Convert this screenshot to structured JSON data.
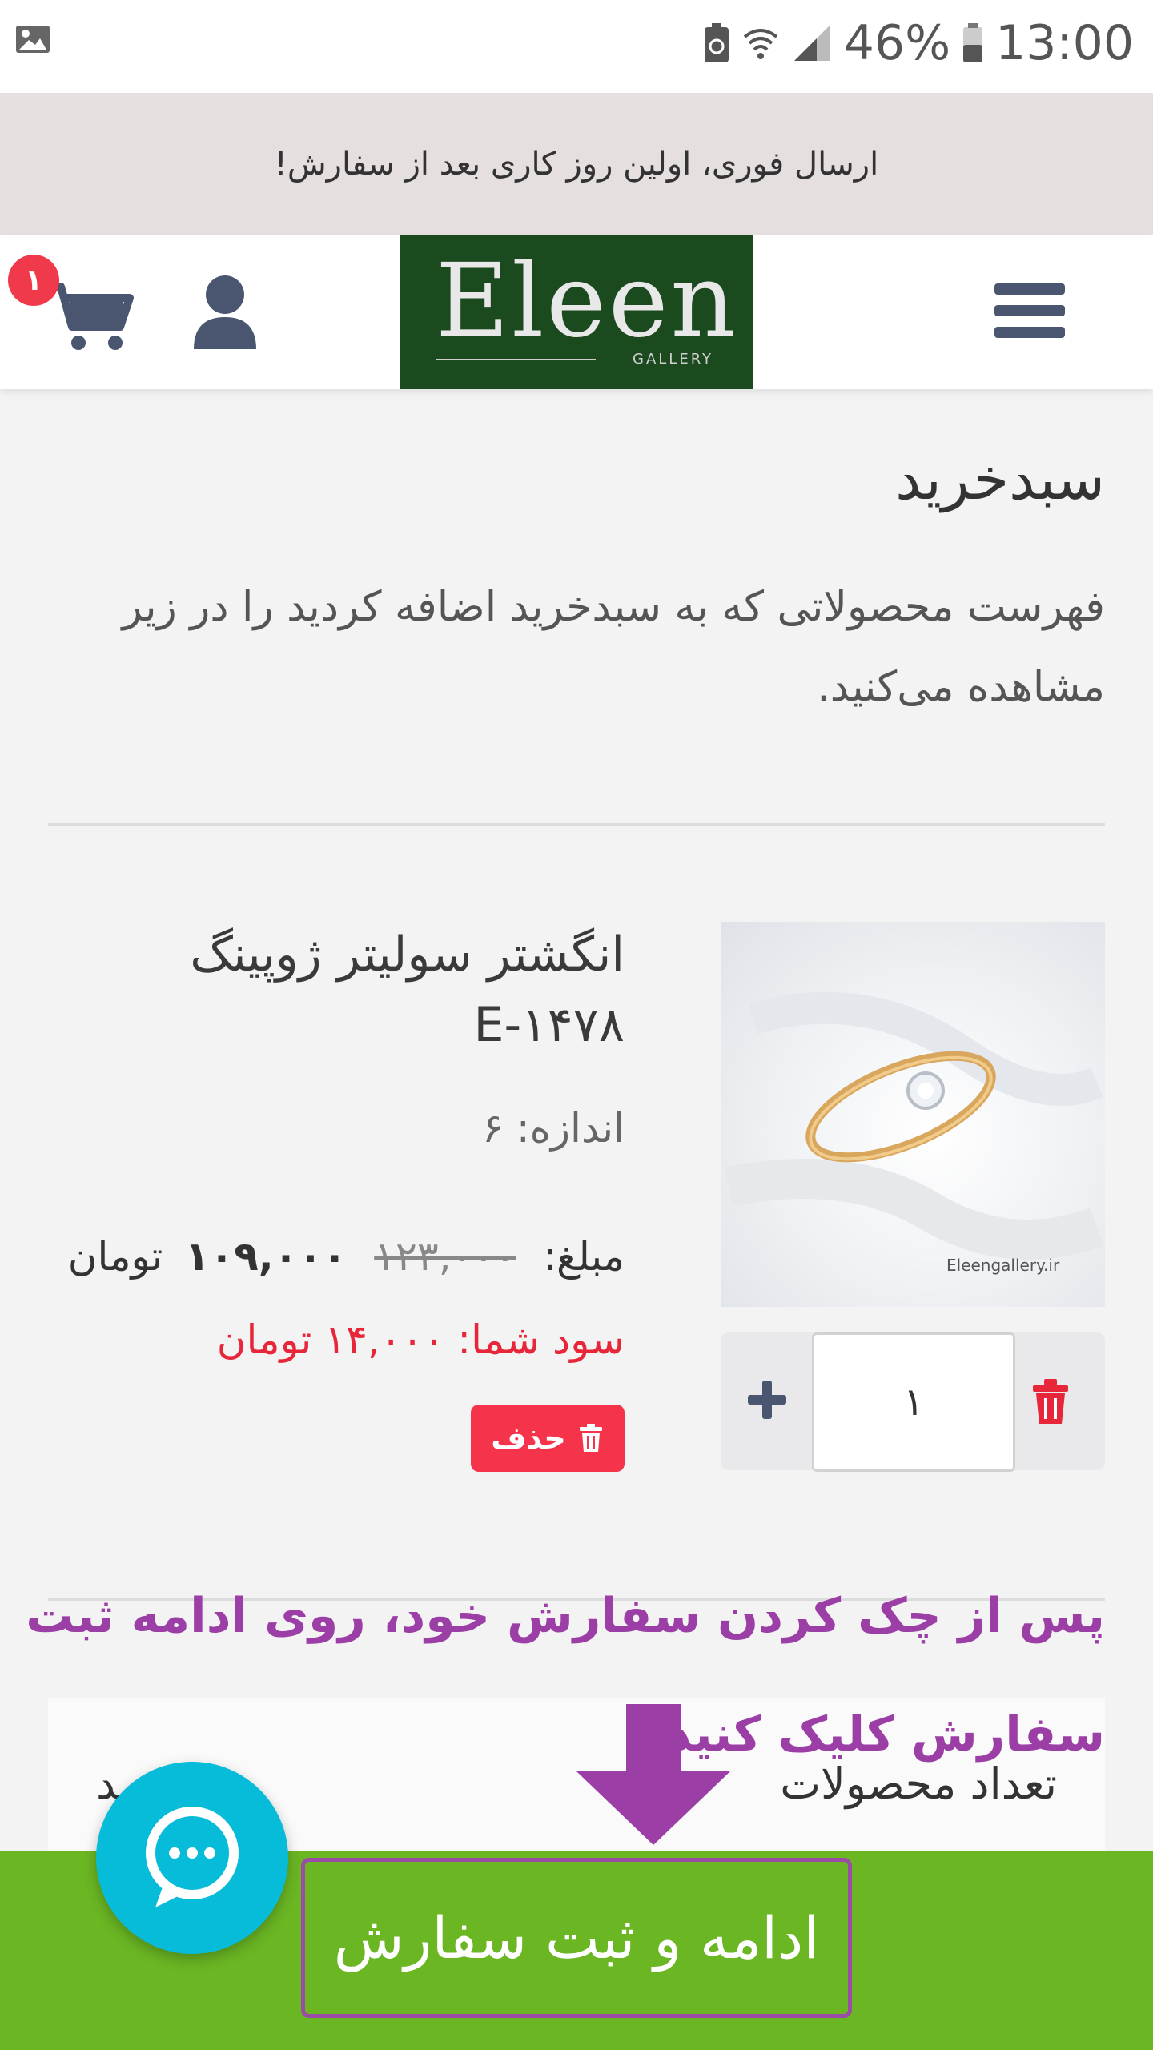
{
  "status_bar": {
    "battery_percent": "46%",
    "time": "13:00",
    "icons": [
      "gallery-icon",
      "battery-saver-icon",
      "wifi-icon",
      "signal-icon",
      "battery-icon"
    ]
  },
  "promo_banner": {
    "text": "ارسال فوری، اولین روز کاری بعد از سفارش!"
  },
  "header": {
    "logo_text": "Eleen",
    "logo_subtext": "GALLERY",
    "cart_count": "۱",
    "icons": [
      "hamburger-menu-icon",
      "user-icon",
      "cart-icon"
    ]
  },
  "cart_page": {
    "title": "سبدخرید",
    "description": "فهرست محصولاتی که به سبدخرید اضافه کردید را در زیر مشاهده می‌کنید."
  },
  "product": {
    "name": "انگشتر سولیتر ژوپینگ E-۱۴۷۸",
    "size_label": "اندازه: ۶",
    "price_label": "مبلغ:",
    "old_price": "۱۲۳,۰۰۰",
    "new_price": "۱۰۹,۰۰۰",
    "currency": "تومان",
    "savings_label": "سود شما:",
    "savings_value": "۱۴,۰۰۰ تومان",
    "image_watermark": "Eleengallery.ir",
    "quantity": "۱",
    "delete_label": "حذف"
  },
  "instruction": {
    "text": "پس از چک کردن سفارش خود، روی ادامه ثبت سفارش کلیک کنید"
  },
  "summary": {
    "products_count_label": "تعداد محصولات",
    "products_count_value": "ـد"
  },
  "footer": {
    "checkout_label": "ادامه و ثبت سفارش"
  },
  "colors": {
    "footer_green": "#6ab623",
    "instruction_purple": "#9b3ea5",
    "delete_red": "#f5334a",
    "chat_cyan": "#07bcd8",
    "logo_green": "#1b4a1f"
  }
}
